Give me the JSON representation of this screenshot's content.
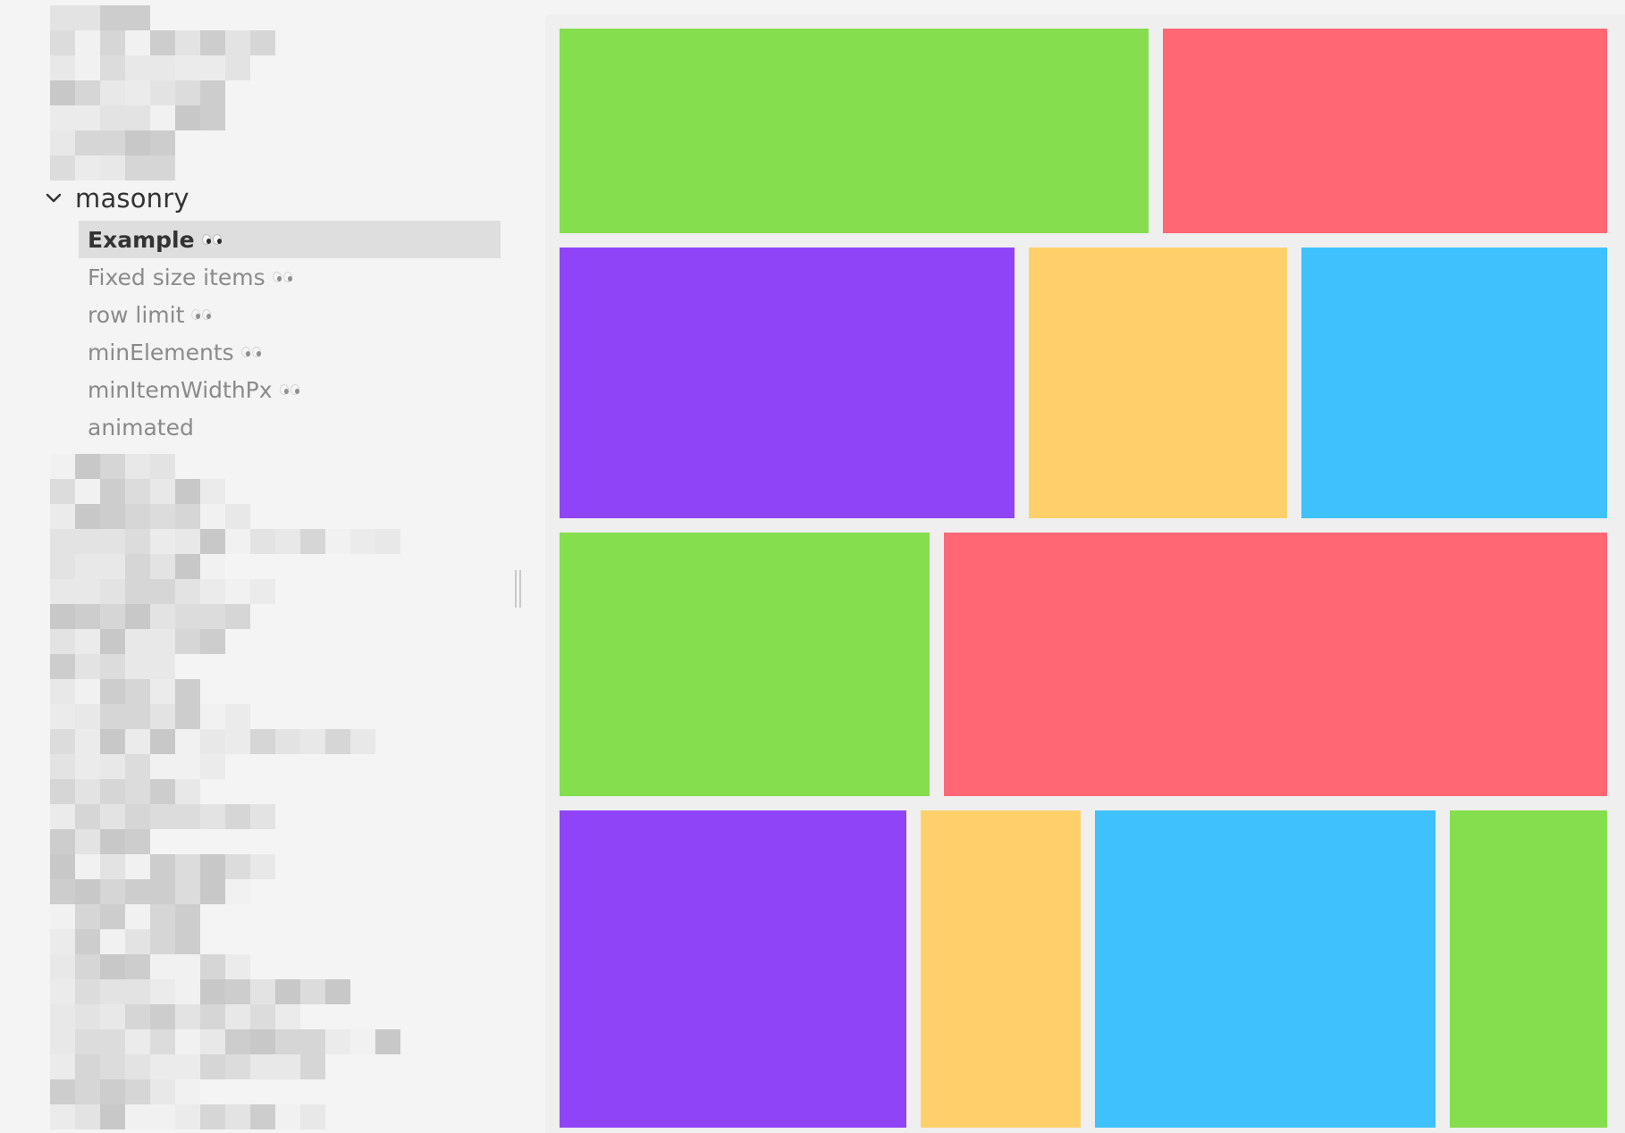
{
  "sidebar": {
    "group": {
      "label": "masonry",
      "expanded": true,
      "icon": "chevron-down-icon"
    },
    "stories": [
      {
        "label": "Example",
        "active": true,
        "has_eyes": true
      },
      {
        "label": "Fixed size items",
        "active": false,
        "has_eyes": true
      },
      {
        "label": "row limit",
        "active": false,
        "has_eyes": true
      },
      {
        "label": "minElements",
        "active": false,
        "has_eyes": true
      },
      {
        "label": "minItemWidthPx",
        "active": false,
        "has_eyes": true
      },
      {
        "label": "animated",
        "active": false,
        "has_eyes": false
      }
    ]
  },
  "preview": {
    "colors": {
      "green": "#85de4e",
      "red": "#ff6775",
      "purple": "#8f44f7",
      "yellow": "#ffd069",
      "blue": "#3ec1fc",
      "background": "#efefef"
    },
    "rows": [
      {
        "tiles": [
          "green",
          "red"
        ]
      },
      {
        "tiles": [
          "purple",
          "yellow",
          "blue"
        ]
      },
      {
        "tiles": [
          "green",
          "red"
        ]
      },
      {
        "tiles": [
          "purple",
          "yellow",
          "blue",
          "green"
        ]
      }
    ]
  }
}
